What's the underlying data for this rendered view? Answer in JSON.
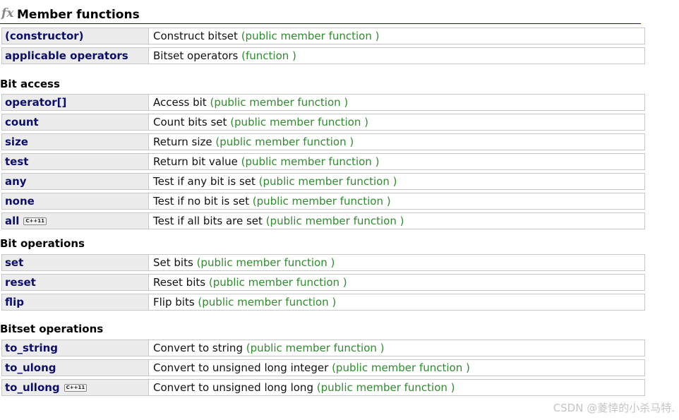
{
  "header": {
    "icon": "fx",
    "title": "Member functions"
  },
  "top_rows": [
    {
      "name": "(constructor)",
      "desc": "Construct bitset",
      "kind": "(public member function )"
    },
    {
      "name": "applicable operators",
      "desc": "Bitset operators",
      "kind": "(function )"
    }
  ],
  "bit_access": {
    "title": "Bit access",
    "rows": [
      {
        "name": "operator[]",
        "desc": "Access bit",
        "kind": "(public member function )"
      },
      {
        "name": "count",
        "desc": "Count bits set",
        "kind": "(public member function )"
      },
      {
        "name": "size",
        "desc": "Return size",
        "kind": "(public member function )"
      },
      {
        "name": "test",
        "desc": "Return bit value",
        "kind": "(public member function )"
      },
      {
        "name": "any",
        "desc": "Test if any bit is set",
        "kind": "(public member function )"
      },
      {
        "name": "none",
        "desc": "Test if no bit is set",
        "kind": "(public member function )"
      },
      {
        "name": "all",
        "badge": "C++11",
        "desc": "Test if all bits are set",
        "kind": "(public member function )"
      }
    ]
  },
  "bit_operations": {
    "title": "Bit operations",
    "rows": [
      {
        "name": "set",
        "desc": "Set bits",
        "kind": "(public member function )"
      },
      {
        "name": "reset",
        "desc": "Reset bits",
        "kind": "(public member function )"
      },
      {
        "name": "flip",
        "desc": "Flip bits",
        "kind": "(public member function )"
      }
    ]
  },
  "bitset_operations": {
    "title": "Bitset operations",
    "rows": [
      {
        "name": "to_string",
        "desc": "Convert to string",
        "kind": "(public member function )"
      },
      {
        "name": "to_ulong",
        "desc": "Convert to unsigned long integer",
        "kind": "(public member function )"
      },
      {
        "name": "to_ullong",
        "badge": "C++11",
        "desc": "Convert to unsigned long long",
        "kind": "(public member function )"
      }
    ]
  },
  "watermark": "CSDN @菱悻的小杀马特."
}
